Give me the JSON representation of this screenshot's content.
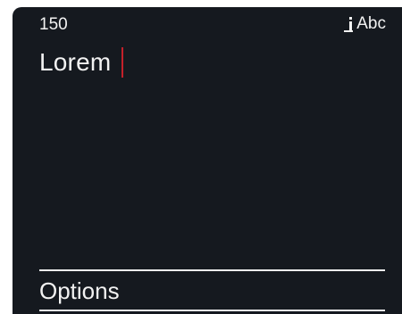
{
  "status_bar": {
    "counter": "150",
    "input_mode": "Abc",
    "input_mode_icon": "text-cursor-icon"
  },
  "editor": {
    "text": "Lorem",
    "caret_color": "#c4202a"
  },
  "softkey": {
    "options_label": "Options"
  },
  "colors": {
    "background": "#15191f",
    "foreground": "#f2f2f2",
    "accent": "#c4202a"
  }
}
